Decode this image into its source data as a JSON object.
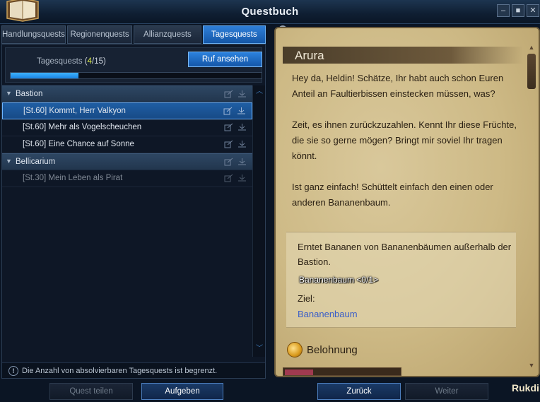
{
  "window": {
    "title": "Questbuch"
  },
  "tabs": [
    {
      "label": "Handlungsquests"
    },
    {
      "label": "Regionenquests"
    },
    {
      "label": "Allianzquests"
    },
    {
      "label": "Tagesquests"
    }
  ],
  "daily": {
    "label": "Tagesquests",
    "current": "4",
    "separator": "/",
    "max": "15",
    "progress": 0.27,
    "ruf_button": "Ruf ansehen"
  },
  "groups": [
    {
      "name": "Bastion",
      "quests": [
        {
          "name": "[St.60] Kommt, Herr Valkyon"
        },
        {
          "name": "[St.60] Mehr als Vogelscheuchen"
        },
        {
          "name": "[St.60] Eine Chance auf Sonne"
        }
      ]
    },
    {
      "name": "Bellicarium",
      "quests": [
        {
          "name": "[St.30] Mein Leben als Pirat"
        }
      ]
    }
  ],
  "notice": {
    "text": "Die Anzahl von absolvierbaren Tagesquests ist begrenzt."
  },
  "buttons": {
    "share": "Quest teilen",
    "abandon": "Aufgeben",
    "back": "Zurück",
    "next": "Weiter"
  },
  "quest_detail": {
    "npc": "Arura",
    "paragraphs": [
      "Hey da, Heldin! Schätze, Ihr habt auch schon Euren Anteil an Faultierbissen einstecken müssen, was?",
      "Zeit, es ihnen zurückzuzahlen. Kennt Ihr diese Früchte, die sie so gerne mögen? Bringt mir soviel Ihr tragen könnt.",
      "Ist ganz einfach! Schüttelt einfach den einen oder anderen Bananenbaum."
    ],
    "objective": "Erntet Bananen von Bananenbäumen außerhalb der Bastion.",
    "objective_progress": "Bananenbaum <0/1>",
    "target_label": "Ziel:",
    "target": "Bananenbaum",
    "reward_label": "Belohnung"
  },
  "character_name": "Rukdi",
  "colors": {
    "accent_blue": "#2c82de",
    "selected_row": "#1f5ea4",
    "count_highlight": "#d9e84a",
    "target_link": "#3a5ec8",
    "parchment": "#cdb985"
  },
  "icons": {
    "title": "quest-book-icon",
    "row_actions": [
      "share-quest-icon",
      "track-quest-icon"
    ],
    "notice": "info-icon",
    "reward": "gold-coin-icon"
  }
}
